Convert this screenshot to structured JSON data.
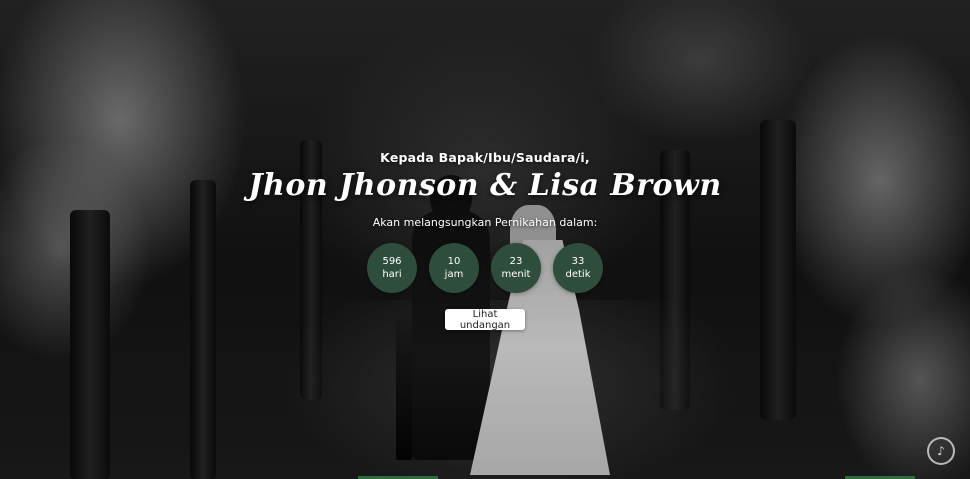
{
  "hero": {
    "greeting": "Kepada Bapak/Ibu/Saudara/i,",
    "couple_names": "Jhon Jhonson & Lisa Brown",
    "subtitle": "Akan melangsungkan Pernikahan dalam:",
    "countdown": [
      {
        "value": "596",
        "unit": "hari"
      },
      {
        "value": "10",
        "unit": "jam"
      },
      {
        "value": "23",
        "unit": "menit"
      },
      {
        "value": "33",
        "unit": "detik"
      }
    ],
    "cta_label": "Lihat undangan"
  },
  "music": {
    "icon": "music-disc-icon"
  },
  "colors": {
    "accent": "#2f4d3c",
    "button_bg": "#ffffff",
    "bottom_bar": "#2f6b3e"
  }
}
